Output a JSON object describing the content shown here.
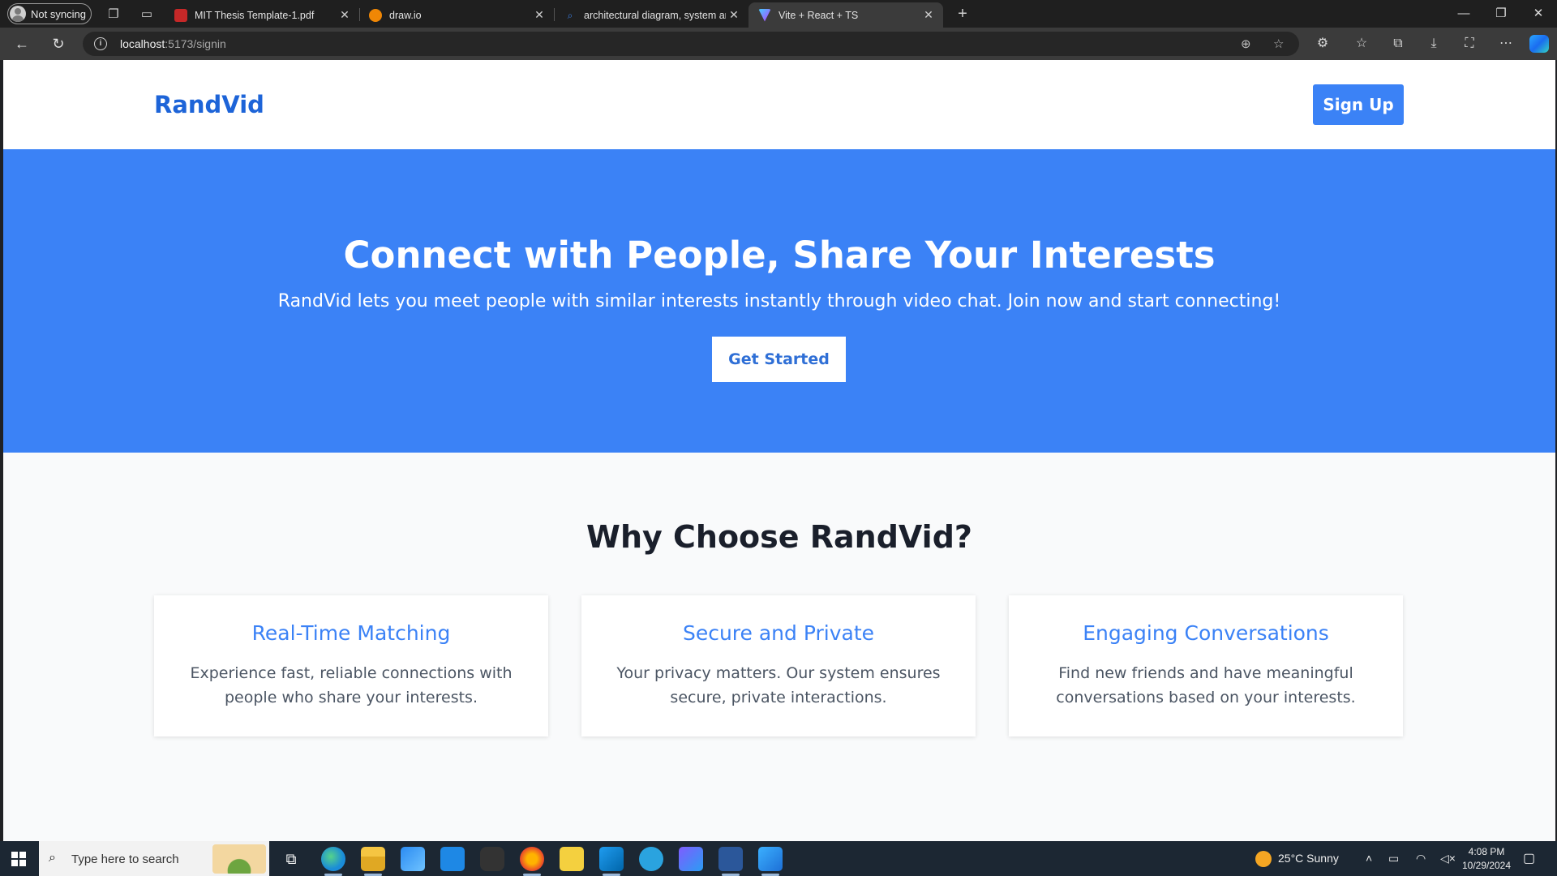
{
  "browser": {
    "profile_label": "Not syncing",
    "tabs": [
      {
        "title": "MIT Thesis Template-1.pdf",
        "favicon": "pdf-icon"
      },
      {
        "title": "draw.io",
        "favicon": "drawio-icon"
      },
      {
        "title": "architectural diagram, system arch",
        "favicon": "search-icon"
      },
      {
        "title": "Vite + React + TS",
        "favicon": "vite-icon",
        "active": true
      }
    ],
    "url_host": "localhost",
    "url_path": ":5173/signin"
  },
  "site": {
    "logo": "RandVid",
    "signup_label": "Sign Up",
    "hero": {
      "title": "Connect with People, Share Your Interests",
      "subtitle": "RandVid lets you meet people with similar interests instantly through video chat. Join now and start connecting!",
      "cta_label": "Get Started"
    },
    "features": {
      "heading": "Why Choose RandVid?",
      "cards": [
        {
          "title": "Real-Time Matching",
          "text": "Experience fast, reliable connections with people who share your interests."
        },
        {
          "title": "Secure and Private",
          "text": "Your privacy matters. Our system ensures secure, private interactions."
        },
        {
          "title": "Engaging Conversations",
          "text": "Find new friends and have meaningful conversations based on your interests."
        }
      ]
    },
    "colors": {
      "primary": "#3b82f6",
      "logo": "#1d64d8",
      "heading": "#1a1f2b"
    }
  },
  "taskbar": {
    "search_placeholder": "Type here to search",
    "weather": "25°C  Sunny",
    "time": "4:08 PM",
    "date": "10/29/2024",
    "apps": [
      "edge-icon",
      "file-explorer-icon",
      "store-icon",
      "mail-icon",
      "camera-icon",
      "firefox-icon",
      "sticky-notes-icon",
      "vscode-icon",
      "telegram-icon",
      "copilot-app-icon",
      "word-icon",
      "photos-icon"
    ]
  }
}
